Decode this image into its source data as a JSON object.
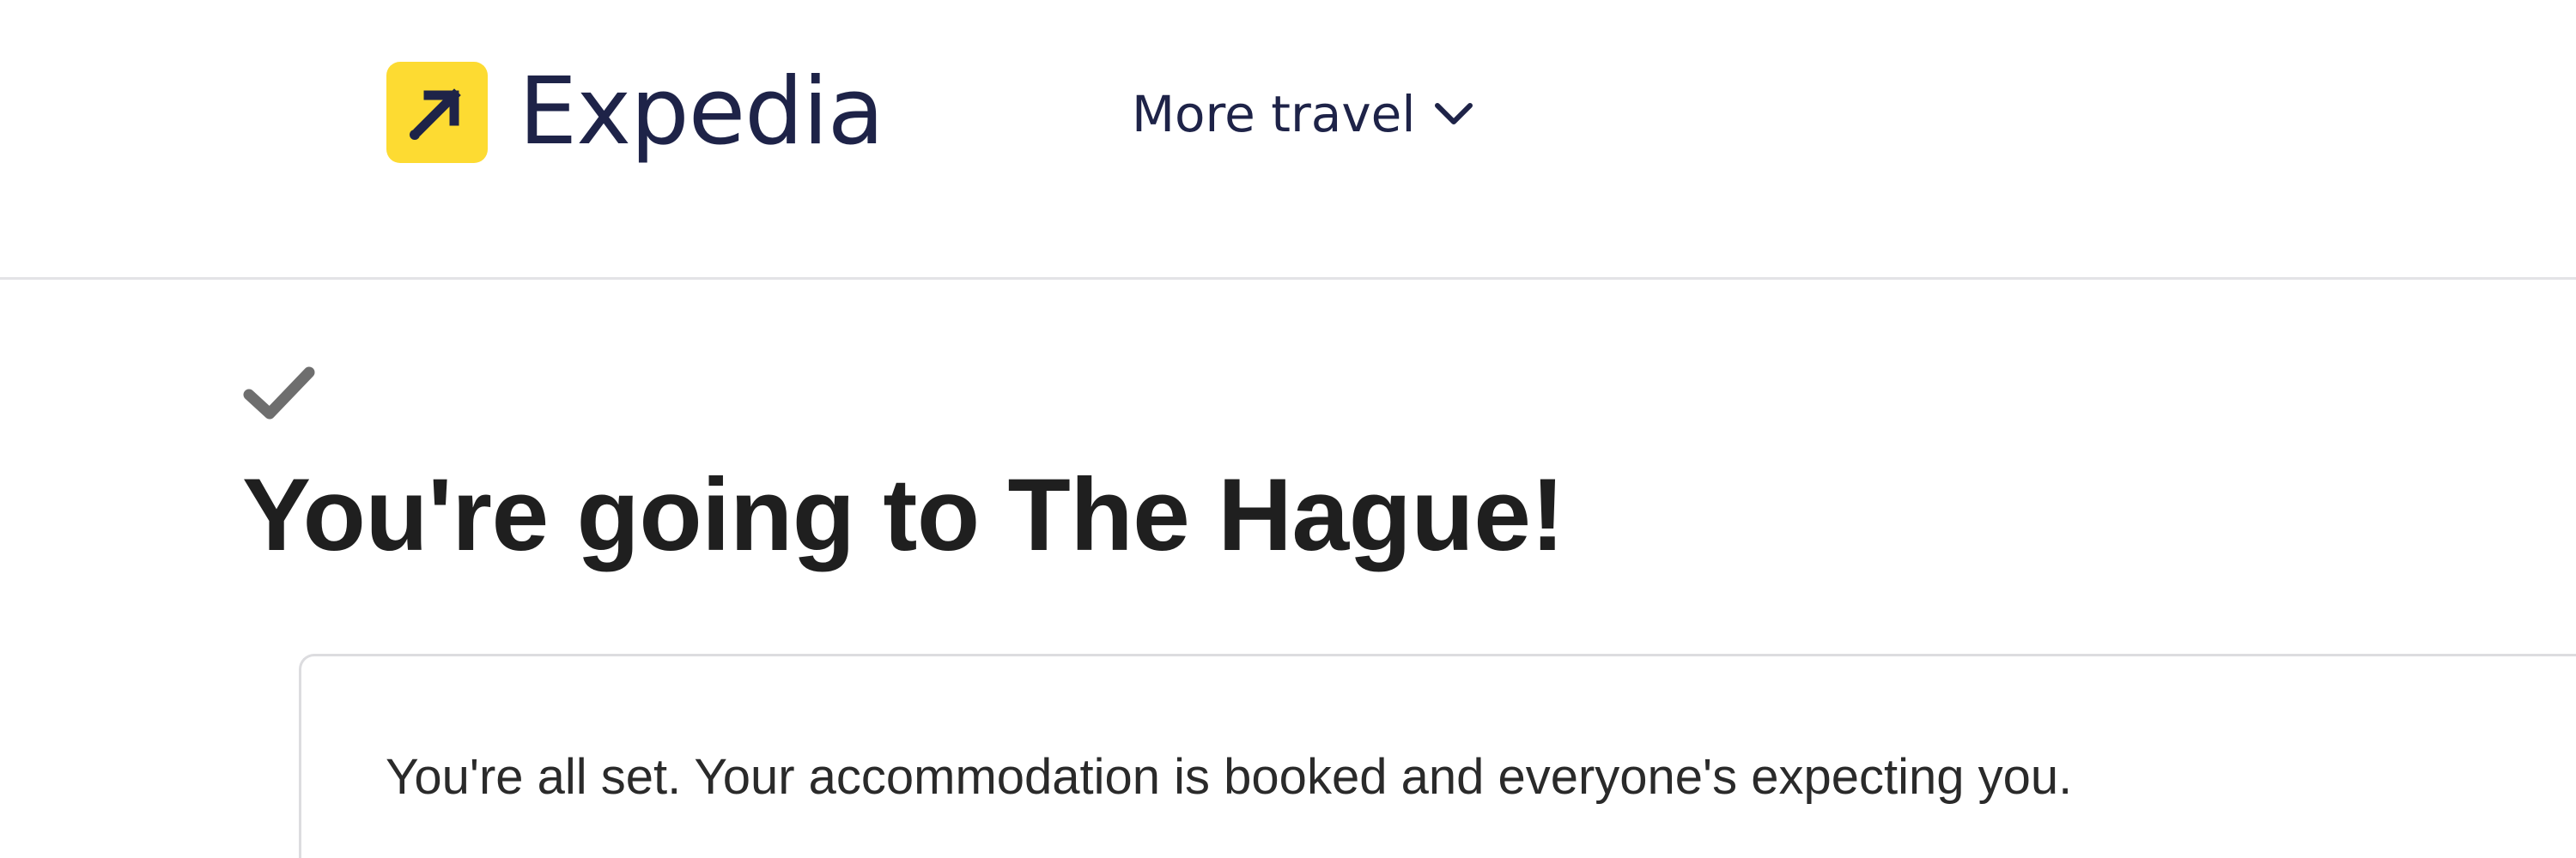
{
  "header": {
    "logo_text": "Expedia",
    "logo_icon": "arrow-up-right-icon",
    "more_travel_label": "More travel",
    "more_travel_icon": "chevron-down-icon"
  },
  "confirmation": {
    "status_icon": "checkmark-icon",
    "title": "You're going to The Hague!",
    "message": "You're all set. Your accommodation is booked and everyone's expecting you."
  },
  "colors": {
    "brand_yellow": "#fddb32",
    "brand_navy": "#1e2348",
    "title_text": "#1f1f1f",
    "check_gray": "#6e6e6e",
    "divider": "#e3e3e6"
  }
}
